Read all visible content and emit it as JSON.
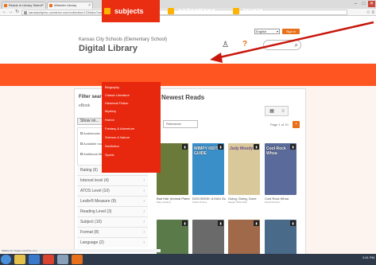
{
  "browser": {
    "tabs": [
      {
        "label": "Reads In Library Select"
      },
      {
        "label": "Wheeler Library"
      }
    ],
    "url": "kansascitymo.overdrive.com/collection/1234abc?sortBy=newlyadded&mediaType=ebook",
    "window_controls": [
      "–",
      "□",
      "✕"
    ]
  },
  "header": {
    "district": "Kansas City Schools (Elementary School)",
    "title": "Digital Library",
    "language": "English",
    "signin_label": "Sign in"
  },
  "nav": {
    "subjects": "subjects",
    "collections": "collections",
    "levels": "levels"
  },
  "subjects_menu": [
    "Biography",
    "Classic Literature",
    "Historical Fiction",
    "Mystery",
    "Humor",
    "Fantasy & Adventure",
    "Science & Nature",
    "Nonfiction",
    "Sports"
  ],
  "filters": {
    "title": "Filter search",
    "ebook": "eBook",
    "show_label": "Show on...",
    "checks": [
      "Audiobooks",
      "Available now",
      "Additional titles"
    ],
    "rows": [
      "Rating (6)",
      "Interest level (4)",
      "ATOS Level (10)",
      "Lexile® Measure (9)",
      "Reading Level (3)",
      "Subject (10)",
      "Format (8)",
      "Language (2)"
    ]
  },
  "content": {
    "title": "Newest Reads",
    "sort_label": "Relevance",
    "page_label": "Page 1 of 10",
    "next": "›"
  },
  "books": [
    {
      "cover": "",
      "title": "Bad Hair (Animal Planet)",
      "author": "Mary Keating",
      "color": "#6a7a3a"
    },
    {
      "cover": "WIMPY KID'S GUIDE",
      "title": "DOG BOOK: A Kid's Guide",
      "author": "Kristin Kinney",
      "color": "#3a8fc9"
    },
    {
      "cover": "Judy Moody",
      "title": "Going, Going, Gone",
      "author": "Megan McDonald",
      "color": "#d8c89a"
    },
    {
      "cover": "Cool Rock Whoa",
      "title": "Cool Rock Whoa",
      "author": "David Dimitrov",
      "color": "#5a6a9a"
    }
  ],
  "books_row2_colors": [
    "#5a7a4a",
    "#6a6a6a",
    "#a06a4a",
    "#4a6a8a"
  ],
  "status": "Waiting for images.overdrive.com...",
  "tray": "2:41 PM"
}
